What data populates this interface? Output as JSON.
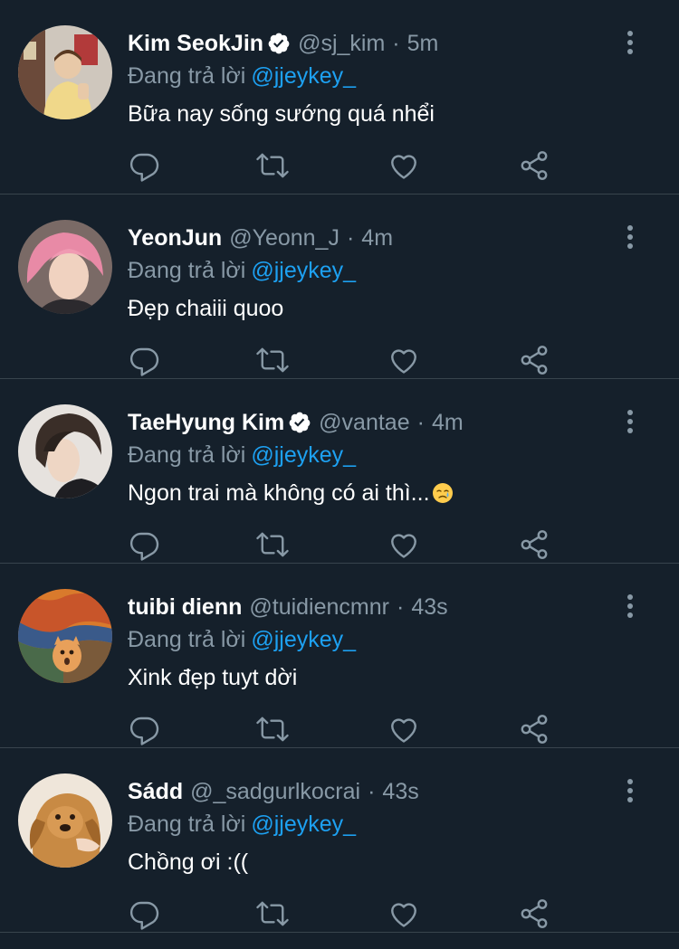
{
  "colors": {
    "background": "#15202b",
    "divider": "#38444d",
    "muted_text": "#8899a6",
    "mention": "#1da1f2",
    "verified_badge": "#ffffff"
  },
  "icons": {
    "reply": "reply-icon",
    "retweet": "retweet-icon",
    "like": "heart-icon",
    "share": "share-icon",
    "more": "more-vertical-icon",
    "verified": "verified-badge-icon"
  },
  "tweets": [
    {
      "name": "Kim SeokJin",
      "verified": true,
      "handle": "@sj_kim",
      "separator": "·",
      "time": "5m",
      "reply_prefix": "Đang trả lời",
      "reply_to": "@jjeykey_",
      "text": "Bữa nay sống sướng quá nhểi",
      "emoji": ""
    },
    {
      "name": "YeonJun",
      "verified": false,
      "handle": "@Yeonn_J",
      "separator": "·",
      "time": "4m",
      "reply_prefix": "Đang trả lời",
      "reply_to": "@jjeykey_",
      "text": "Đẹp chaiii quoo",
      "emoji": ""
    },
    {
      "name": "TaeHyung Kim",
      "verified": true,
      "handle": "@vantae",
      "separator": "·",
      "time": "4m",
      "reply_prefix": "Đang trả lời",
      "reply_to": "@jjeykey_",
      "text": "Ngon trai mà không có ai thì...",
      "emoji": "crying-face-emoji"
    },
    {
      "name": "tuibi dienn",
      "verified": false,
      "handle": "@tuidiencmnr",
      "separator": "·",
      "time": "43s",
      "reply_prefix": "Đang trả lời",
      "reply_to": "@jjeykey_",
      "text": "Xink đẹp tuyt dời",
      "emoji": ""
    },
    {
      "name": "Sádd",
      "verified": false,
      "handle": "@_sadgurlkocrai",
      "separator": "·",
      "time": "43s",
      "reply_prefix": "Đang trả lời",
      "reply_to": "@jjeykey_",
      "text": "Chồng ơi :((",
      "emoji": ""
    }
  ]
}
